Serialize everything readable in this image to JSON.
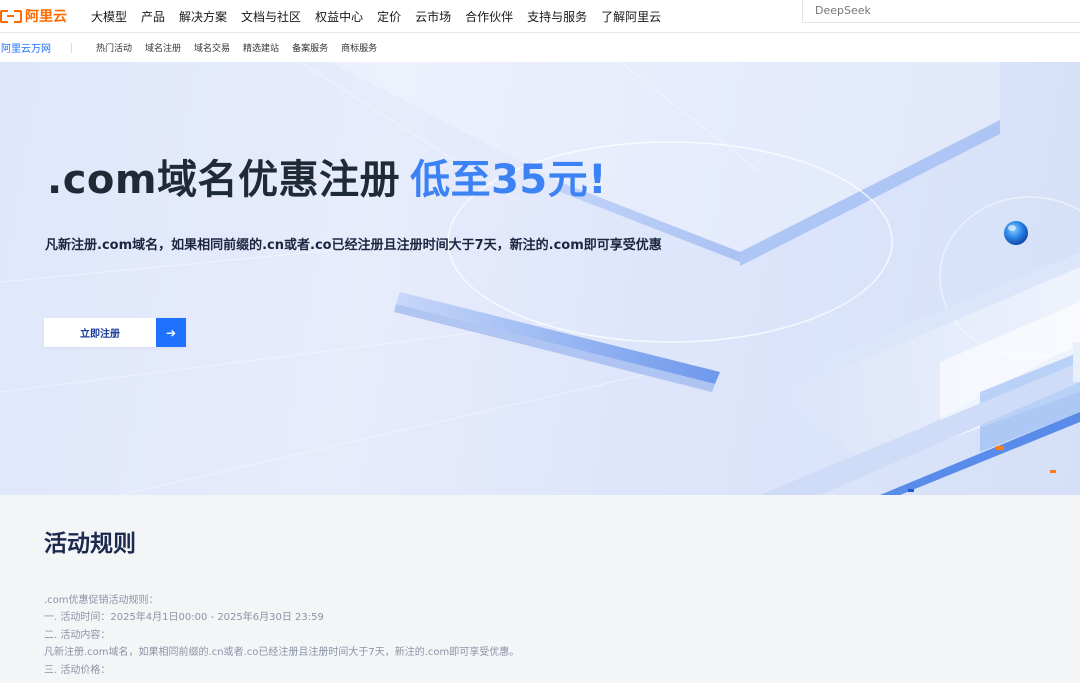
{
  "header": {
    "logo_text": "阿里云",
    "nav_items": [
      "大模型",
      "产品",
      "解决方案",
      "文档与社区",
      "权益中心",
      "定价",
      "云市场",
      "合作伙伴",
      "支持与服务",
      "了解阿里云"
    ],
    "search_placeholder": "DeepSeek"
  },
  "subnav": {
    "brand": "阿里云万网",
    "items": [
      "热门活动",
      "域名注册",
      "域名交易",
      "精选建站",
      "备案服务",
      "商标服务"
    ]
  },
  "hero": {
    "title_main": ".com域名优惠注册",
    "title_accent": "低至35元!",
    "subtitle": "凡新注册.com域名，如果相同前缀的.cn或者.co已经注册且注册时间大于7天，新注的.com即可享受优惠",
    "cta_label": "立即注册",
    "cta_arrow": "➔"
  },
  "rules": {
    "title": "活动规则",
    "lines": [
      ".com优惠促销活动规则：",
      "一. 活动时间：2025年4月1日00:00 - 2025年6月30日 23:59",
      "二. 活动内容：",
      "凡新注册.com域名，如果相同前缀的.cn或者.co已经注册且注册时间大于7天，新注的.com即可享受优惠。",
      "三. 活动价格："
    ]
  },
  "colors": {
    "brand_orange": "#ff6a00",
    "accent_blue": "#1f71ff",
    "title_accent": "#3d82f5"
  }
}
